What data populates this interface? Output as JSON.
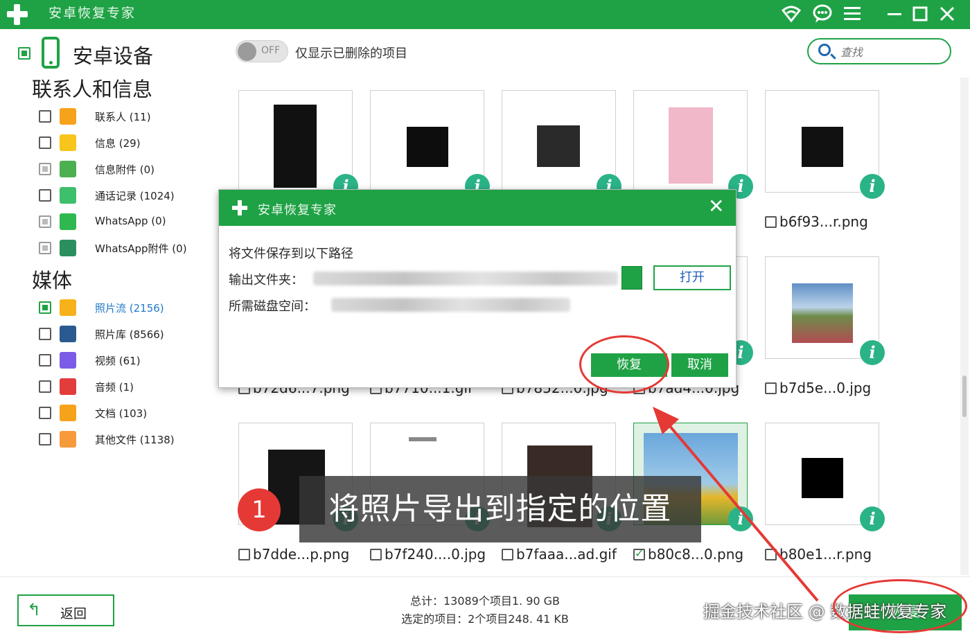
{
  "app": {
    "title": "安卓恢复专家"
  },
  "titlebar_icons": [
    "wifi-icon",
    "chat-icon",
    "menu-icon",
    "minimize-icon",
    "maximize-icon",
    "close-icon"
  ],
  "sidebar": {
    "device_label": "安卓设备",
    "section_contacts": "联系人和信息",
    "section_media": "媒体",
    "contacts_items": [
      {
        "label": "联系人 (11)",
        "icon": "contact-icon",
        "color": "#f7a21b",
        "state": "unchecked"
      },
      {
        "label": "信息 (29)",
        "icon": "message-icon",
        "color": "#f7c51b",
        "state": "unchecked"
      },
      {
        "label": "信息附件 (0)",
        "icon": "attachment-icon",
        "color": "#4caf50",
        "state": "disabled"
      },
      {
        "label": "通话记录 (1024)",
        "icon": "phone-icon",
        "color": "#3dbf6b",
        "state": "unchecked"
      },
      {
        "label": "WhatsApp (0)",
        "icon": "whatsapp-icon",
        "color": "#2eb84f",
        "state": "disabled"
      },
      {
        "label": "WhatsApp附件 (0)",
        "icon": "whatsapp-attachment-icon",
        "color": "#2a8f5c",
        "state": "disabled"
      }
    ],
    "media_items": [
      {
        "label": "照片流 (2156)",
        "icon": "star-icon",
        "color": "#f7b21b",
        "state": "partial",
        "active": true
      },
      {
        "label": "照片库 (8566)",
        "icon": "gallery-icon",
        "color": "#2a5a8f",
        "state": "unchecked"
      },
      {
        "label": "视频 (61)",
        "icon": "video-icon",
        "color": "#7b5ce6",
        "state": "unchecked"
      },
      {
        "label": "音频 (1)",
        "icon": "music-icon",
        "color": "#e23c3c",
        "state": "unchecked"
      },
      {
        "label": "文档 (103)",
        "icon": "document-icon",
        "color": "#f7a21b",
        "state": "unchecked"
      },
      {
        "label": "其他文件 (1138)",
        "icon": "other-file-icon",
        "color": "#f79a3b",
        "state": "unchecked"
      }
    ]
  },
  "toolbar": {
    "toggle_text": "OFF",
    "deleted_only_label": "仅显示已删除的项目",
    "search_placeholder": "查找"
  },
  "files": [
    {
      "name": "",
      "selected": false
    },
    {
      "name": "",
      "selected": false
    },
    {
      "name": "",
      "selected": false
    },
    {
      "name": "",
      "selected": false
    },
    {
      "name": "b6f93...r.png",
      "selected": false
    },
    {
      "name": "b72d6...7.png",
      "selected": false
    },
    {
      "name": "b7710...1.gif",
      "selected": false
    },
    {
      "name": "b7852...0.jpg",
      "selected": false
    },
    {
      "name": "b7ad4...0.jpg",
      "selected": false
    },
    {
      "name": "b7d5e...0.jpg",
      "selected": false
    },
    {
      "name": "b7dde...p.png",
      "selected": false
    },
    {
      "name": "b7f240....0.jpg",
      "selected": false
    },
    {
      "name": "b7faaa...ad.gif",
      "selected": false
    },
    {
      "name": "b80c8...0.png",
      "selected": true
    },
    {
      "name": "b80e1...r.png",
      "selected": false
    }
  ],
  "dialog": {
    "title": "安卓恢复专家",
    "save_prompt": "将文件保存到以下路径",
    "output_folder_label": "输出文件夹：",
    "disk_space_label": "所需磁盘空间：",
    "open_label": "打开",
    "recover_label": "恢复",
    "cancel_label": "取消"
  },
  "bottom": {
    "back_label": "返回",
    "total_text": "总计：13089个项目1. 90 GB",
    "selected_text": "选定的项目：2个项目248. 41 KB",
    "recover_main_label": "恢复",
    "watermark": "掘金技术社区 @ 数据蛙恢复专家"
  },
  "annotation": {
    "step_number": "1",
    "caption": "将照片导出到指定的位置"
  },
  "colors": {
    "brand_green": "#1fa245",
    "annotation_red": "#e53935",
    "info_badge": "#2bb388"
  }
}
